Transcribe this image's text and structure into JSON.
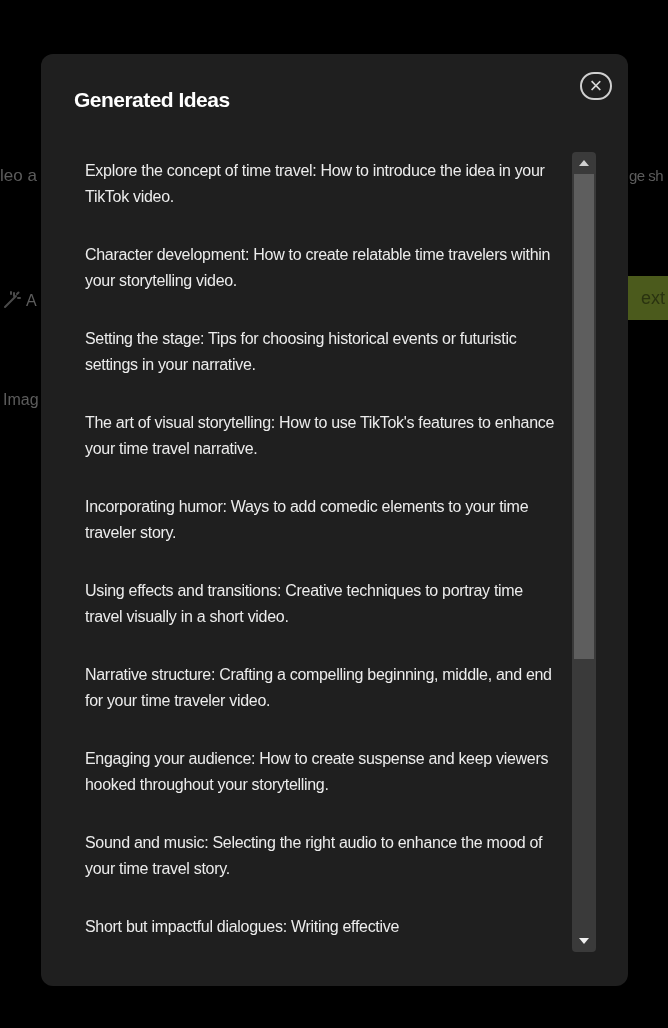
{
  "background": {
    "fragments": [
      {
        "kind": "text",
        "text": "leo a"
      },
      {
        "kind": "wand",
        "text": "A"
      },
      {
        "kind": "text",
        "text": "Imag"
      },
      {
        "kind": "text",
        "text": "ge sh"
      },
      {
        "kind": "button",
        "text": "ext"
      }
    ]
  },
  "dialog": {
    "title": "Generated Ideas",
    "close_label": "×",
    "ideas": [
      "Explore the concept of time travel: How to introduce the idea in your TikTok video.",
      "Character development: How to create relatable time travelers within your storytelling video.",
      "Setting the stage: Tips for choosing historical events or futuristic settings in your narrative.",
      "The art of visual storytelling: How to use TikTok's features to enhance your time travel narrative.",
      "Incorporating humor: Ways to add comedic elements to your time traveler story.",
      "Using effects and transitions: Creative techniques to portray time travel visually in a short video.",
      "Narrative structure: Crafting a compelling beginning, middle, and end for your time traveler video.",
      "Engaging your audience: How to create suspense and keep viewers hooked throughout your storytelling.",
      "Sound and music: Selecting the right audio to enhance the mood of your time travel story.",
      "Short but impactful dialogues: Writing effective"
    ]
  }
}
